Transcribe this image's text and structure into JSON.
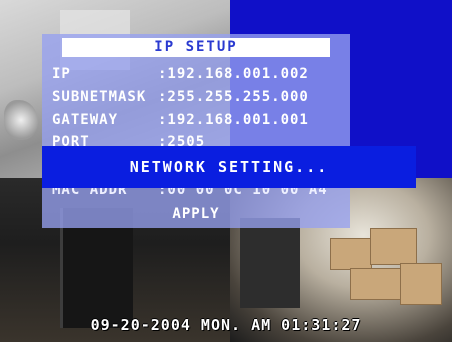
{
  "menu": {
    "title": "IP SETUP",
    "fields": [
      {
        "label": "IP",
        "value": ":192.168.001.002"
      },
      {
        "label": "SUBNETMASK",
        "value": ":255.255.255.000"
      },
      {
        "label": "GATEWAY",
        "value": ":192.168.001.001"
      },
      {
        "label": "PORT",
        "value": ":2505"
      },
      {
        "label": "MAC ADDR",
        "value": ":00 00 0C 10 00 A4"
      }
    ],
    "apply_label": "APPLY"
  },
  "popup": {
    "message": "NETWORK SETTING..."
  },
  "status": {
    "timestamp": "09-20-2004 MON. AM 01:31:27"
  },
  "colors": {
    "popup_bg": "#0a1ee0",
    "panel_bg": "#96a0f0",
    "title_text": "#2a3ad0"
  }
}
